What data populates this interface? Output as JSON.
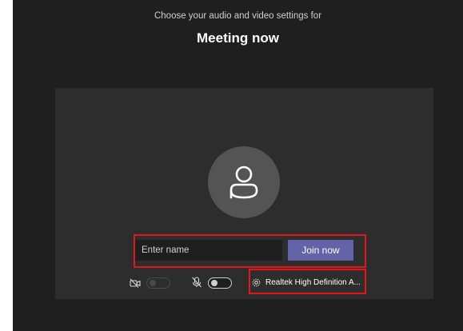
{
  "header": {
    "subtitle": "Choose your audio and video settings for",
    "title": "Meeting now"
  },
  "prejoin": {
    "avatar_icon": "person-icon",
    "name_placeholder": "Enter name",
    "name_value": "",
    "join_label": "Join now"
  },
  "controls": {
    "camera": {
      "icon": "camera-off-icon",
      "on": false,
      "enabled": false
    },
    "microphone": {
      "icon": "mic-off-icon",
      "on": false
    },
    "device": {
      "icon": "gear-icon",
      "label": "Realtek High Definition A..."
    }
  },
  "colors": {
    "window_bg": "#1f1f1f",
    "preview_bg": "#2d2d2d",
    "accent": "#6264a7",
    "highlight": "#e3161c"
  }
}
